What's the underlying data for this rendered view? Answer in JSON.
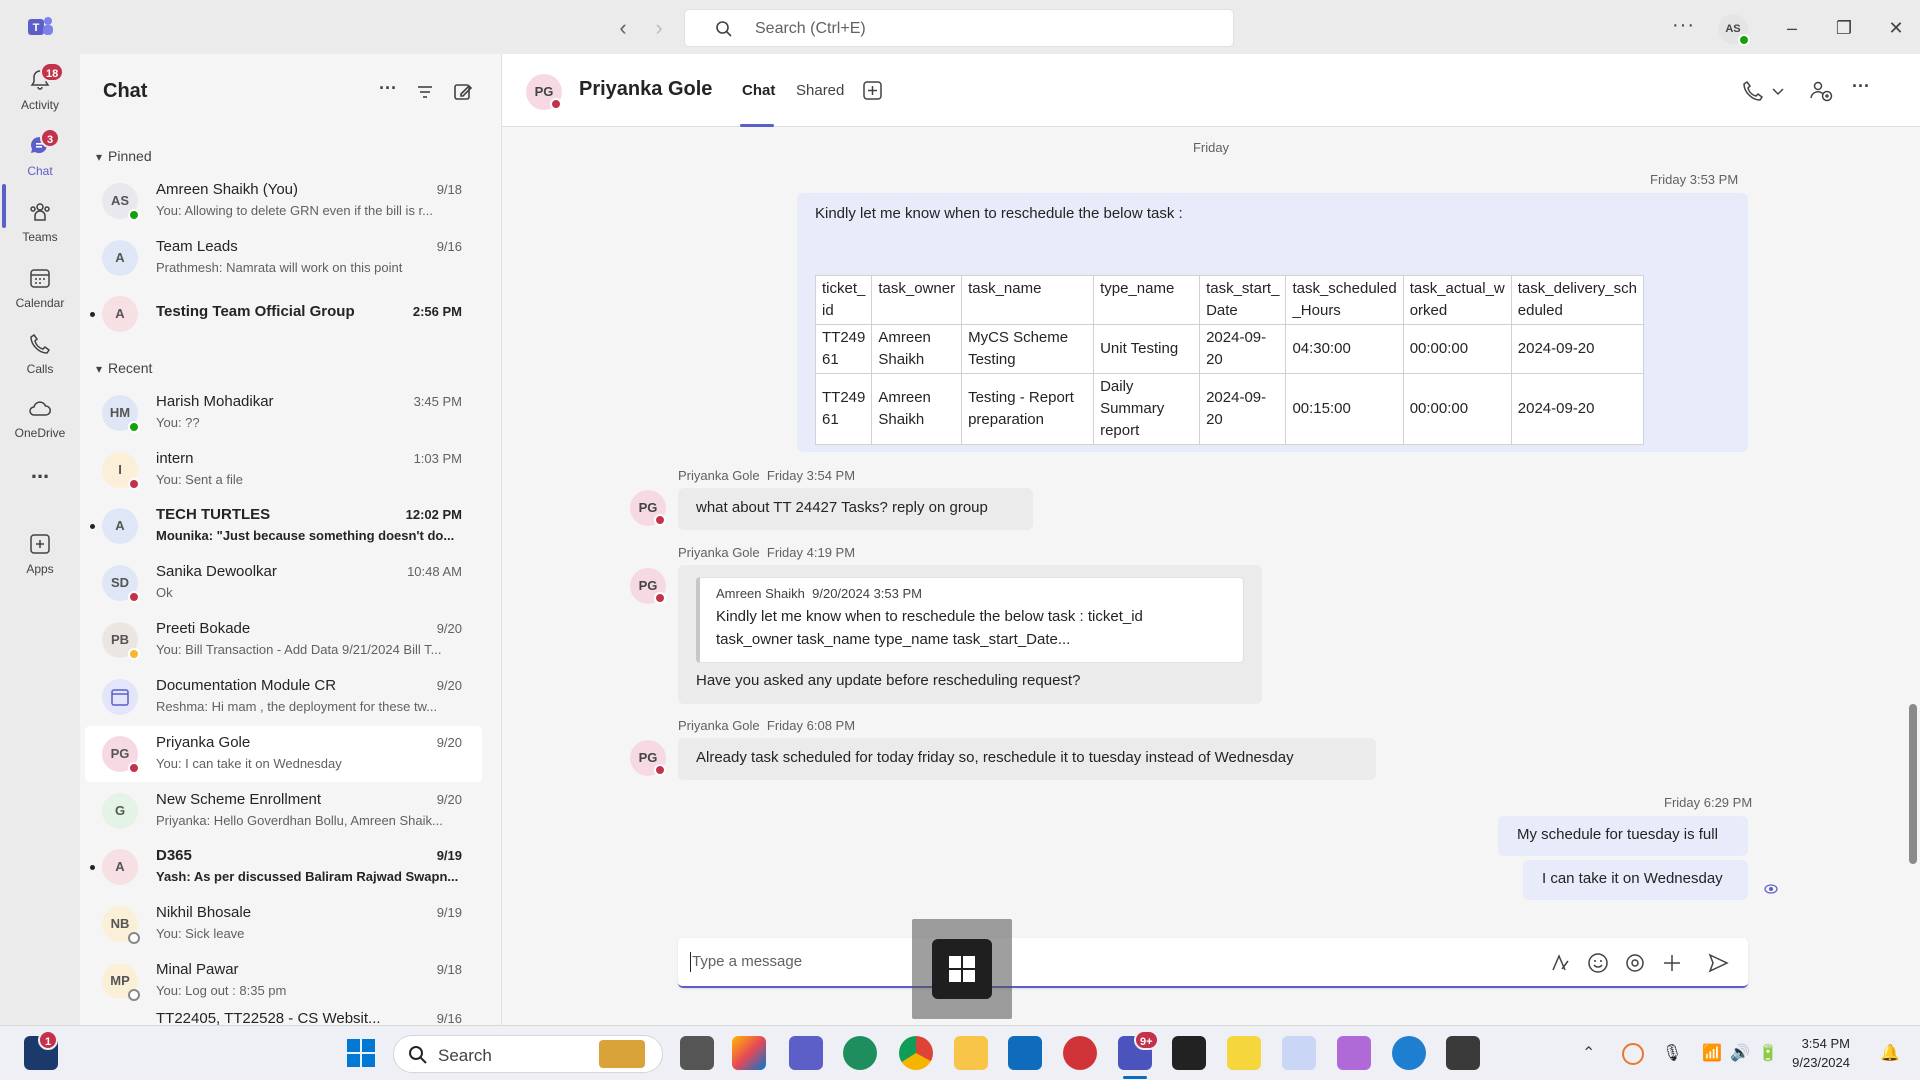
{
  "titlebar": {
    "search_placeholder": "Search (Ctrl+E)",
    "user_initials": "AS"
  },
  "rail": {
    "items": [
      {
        "label": "Activity",
        "badge": "18"
      },
      {
        "label": "Chat",
        "badge": "3"
      },
      {
        "label": "Teams"
      },
      {
        "label": "Calendar"
      },
      {
        "label": "Calls"
      },
      {
        "label": "OneDrive"
      },
      {
        "label": "..."
      },
      {
        "label": "Apps"
      }
    ]
  },
  "chatlist": {
    "title": "Chat",
    "pinned_label": "Pinned",
    "recent_label": "Recent",
    "pinned": [
      {
        "initials": "AS",
        "name": "Amreen Shaikh (You)",
        "time": "9/18",
        "preview": "You: Allowing to delete GRN even if the bill is r..."
      },
      {
        "initials": "A",
        "name": "Team Leads",
        "time": "9/16",
        "preview": "Prathmesh: Namrata will work on this point"
      },
      {
        "initials": "A",
        "name": "Testing Team Official Group",
        "time": "2:56 PM",
        "preview": ""
      }
    ],
    "recent": [
      {
        "initials": "HM",
        "name": "Harish Mohadikar",
        "time": "3:45 PM",
        "preview": "You: ??"
      },
      {
        "initials": "I",
        "name": "intern",
        "time": "1:03 PM",
        "preview": "You: Sent a file"
      },
      {
        "initials": "A",
        "name": "TECH TURTLES",
        "time": "12:02 PM",
        "preview": "Mounika: \"Just because something doesn't do..."
      },
      {
        "initials": "SD",
        "name": "Sanika Dewoolkar",
        "time": "10:48 AM",
        "preview": "Ok"
      },
      {
        "initials": "PB",
        "name": "Preeti Bokade",
        "time": "9/20",
        "preview": "You: Bill Transaction - Add Data 9/21/2024 Bill T..."
      },
      {
        "initials": "",
        "name": "Documentation Module CR",
        "time": "9/20",
        "preview": "Reshma: Hi mam , the deployment for these tw..."
      },
      {
        "initials": "PG",
        "name": "Priyanka Gole",
        "time": "9/20",
        "preview": "You: I can take it on Wednesday"
      },
      {
        "initials": "G",
        "name": "New Scheme Enrollment",
        "time": "9/20",
        "preview": "Priyanka: Hello Goverdhan Bollu, Amreen Shaik..."
      },
      {
        "initials": "A",
        "name": "D365",
        "time": "9/19",
        "preview": "Yash: As per discussed Baliram Rajwad Swapn..."
      },
      {
        "initials": "NB",
        "name": "Nikhil Bhosale",
        "time": "9/19",
        "preview": "You: Sick leave"
      },
      {
        "initials": "MP",
        "name": "Minal Pawar",
        "time": "9/18",
        "preview": "You: Log out : 8:35 pm"
      },
      {
        "initials": "",
        "name": "TT22405, TT22528 - CS Websit...",
        "time": "9/16",
        "preview": ""
      }
    ]
  },
  "header": {
    "initials": "PG",
    "name": "Priyanka Gole",
    "tab_chat": "Chat",
    "tab_shared": "Shared"
  },
  "conversation": {
    "day": "Friday",
    "msg1": {
      "time": "Friday 3:53 PM",
      "text": "Kindly let me know when to reschedule the below task :",
      "table": [
        [
          "ticket_\nid",
          "task_owner",
          "task_name",
          "type_name",
          "task_start_\nDate",
          "task_scheduled\n_Hours",
          "task_actual_w\norked",
          "task_delivery_sch\neduled"
        ],
        [
          "TT249\n61",
          "Amreen\nShaikh",
          "MyCS Scheme\nTesting",
          "Unit Testing",
          "2024-09-\n20",
          "04:30:00",
          "00:00:00",
          "2024-09-20"
        ],
        [
          "TT249\n61",
          "Amreen\nShaikh",
          "Testing - Report\npreparation",
          "Daily Summary\nreport",
          "2024-09-\n20",
          "00:15:00",
          "00:00:00",
          "2024-09-20"
        ]
      ]
    },
    "msg2": {
      "sender": "Priyanka Gole",
      "time": "Friday 3:54 PM",
      "text": "what about TT 24427 Tasks? reply on group"
    },
    "msg3": {
      "sender": "Priyanka Gole",
      "time": "Friday 4:19 PM",
      "quote_sender": "Amreen Shaikh",
      "quote_time": "9/20/2024 3:53 PM",
      "quote_line1": "Kindly let me know when to reschedule the below task : ticket_id",
      "quote_line2": "task_owner task_name type_name task_start_Date...",
      "text": "Have you asked any update before rescheduling request?"
    },
    "msg4": {
      "sender": "Priyanka Gole",
      "time": "Friday 6:08 PM",
      "text": "Already task scheduled for today friday so, reschedule it to tuesday instead of Wednesday"
    },
    "msg5": {
      "time": "Friday 6:29 PM",
      "text1": "My schedule for tuesday is full",
      "text2": "I can take it on Wednesday"
    }
  },
  "composer": {
    "placeholder": "Type a message"
  },
  "taskbar": {
    "search_label": "Search",
    "time": "3:54 PM",
    "date": "9/23/2024",
    "weather_badge": "1",
    "teams_badge": "9+"
  },
  "colors": {
    "accent": "#5b5fc7",
    "bubble_mine": "#e8ebfa",
    "bubble_theirs": "#ebebeb",
    "busy": "#c4314b",
    "available": "#13a10e"
  }
}
